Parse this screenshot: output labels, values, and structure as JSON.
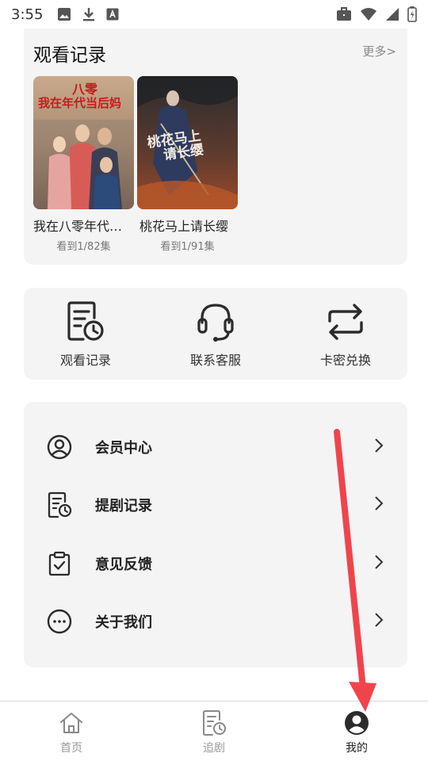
{
  "status_bar": {
    "time": "3:55",
    "icons_left": [
      "image-icon",
      "download-icon",
      "font-icon"
    ],
    "icons_right": [
      "briefcase-icon",
      "wifi-icon",
      "signal-icon",
      "battery-icon"
    ]
  },
  "history": {
    "title": "观看记录",
    "more": "更多>",
    "items": [
      {
        "title": "我在八零年代…",
        "progress": "看到1/82集",
        "poster_text": "八零 我在年代当后妈"
      },
      {
        "title": "桃花马上请长缨",
        "progress": "看到1/91集",
        "poster_text": "桃花马上请长缨"
      }
    ]
  },
  "actions": [
    {
      "label": "观看记录",
      "icon": "history-icon"
    },
    {
      "label": "联系客服",
      "icon": "headset-icon"
    },
    {
      "label": "卡密兑换",
      "icon": "exchange-icon"
    }
  ],
  "menu": [
    {
      "label": "会员中心",
      "icon": "user-circle-icon"
    },
    {
      "label": "提剧记录",
      "icon": "document-clock-icon"
    },
    {
      "label": "意见反馈",
      "icon": "clipboard-check-icon"
    },
    {
      "label": "关于我们",
      "icon": "more-dots-icon"
    }
  ],
  "bottom_nav": [
    {
      "label": "首页",
      "icon": "home-icon",
      "active": false
    },
    {
      "label": "追剧",
      "icon": "document-clock-icon",
      "active": false
    },
    {
      "label": "我的",
      "icon": "profile-icon",
      "active": true
    }
  ],
  "colors": {
    "card_bg": "#f4f4f4",
    "annotation_red": "#f0444c",
    "text_primary": "#222222",
    "text_secondary": "#777777"
  }
}
